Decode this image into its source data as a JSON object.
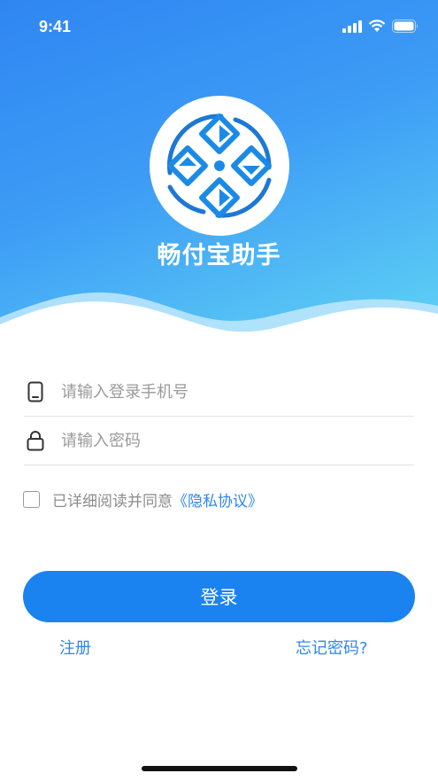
{
  "status_bar": {
    "time": "9:41"
  },
  "app": {
    "name": "畅付宝助手"
  },
  "form": {
    "phone_placeholder": "请输入登录手机号",
    "password_placeholder": "请输入密码"
  },
  "agreement": {
    "text": "已详细阅读并同意",
    "link": "《隐私协议》"
  },
  "buttons": {
    "login": "登录",
    "register": "注册",
    "forgot": "忘记密码?"
  },
  "colors": {
    "primary": "#1b83f0",
    "link": "#2e87ef",
    "gradient_top": "#2f86f2",
    "gradient_bottom": "#62d6f4"
  },
  "icons": {
    "phone": "phone-icon",
    "lock": "lock-icon",
    "signal": "signal-icon",
    "wifi": "wifi-icon",
    "battery": "battery-icon"
  }
}
